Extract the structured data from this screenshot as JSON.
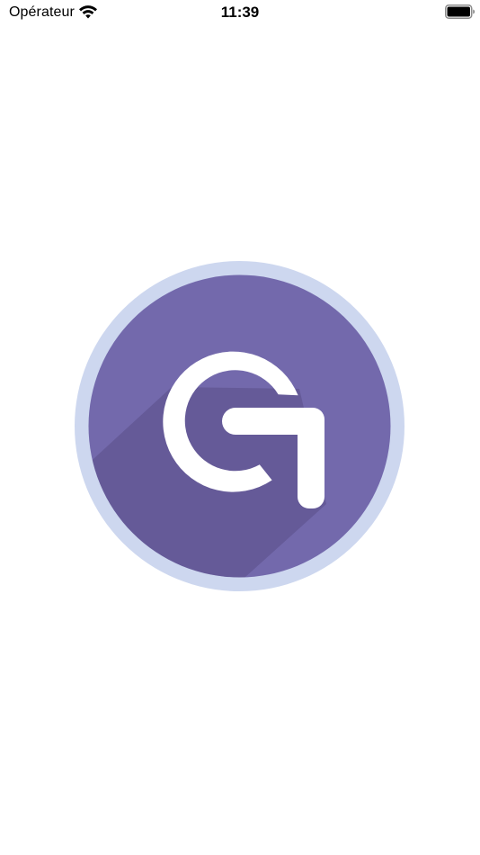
{
  "status_bar": {
    "carrier": "Opérateur",
    "time": "11:39",
    "wifi_icon": "wifi-icon",
    "battery_icon": "battery-icon",
    "battery_level": 1.0
  },
  "splash": {
    "logo_icon": "g-arrow-logo-icon",
    "colors": {
      "ring": "#CDD7EF",
      "circle": "#7369AC",
      "shadow": "#4A3F74",
      "glyph": "#FFFFFF"
    }
  }
}
